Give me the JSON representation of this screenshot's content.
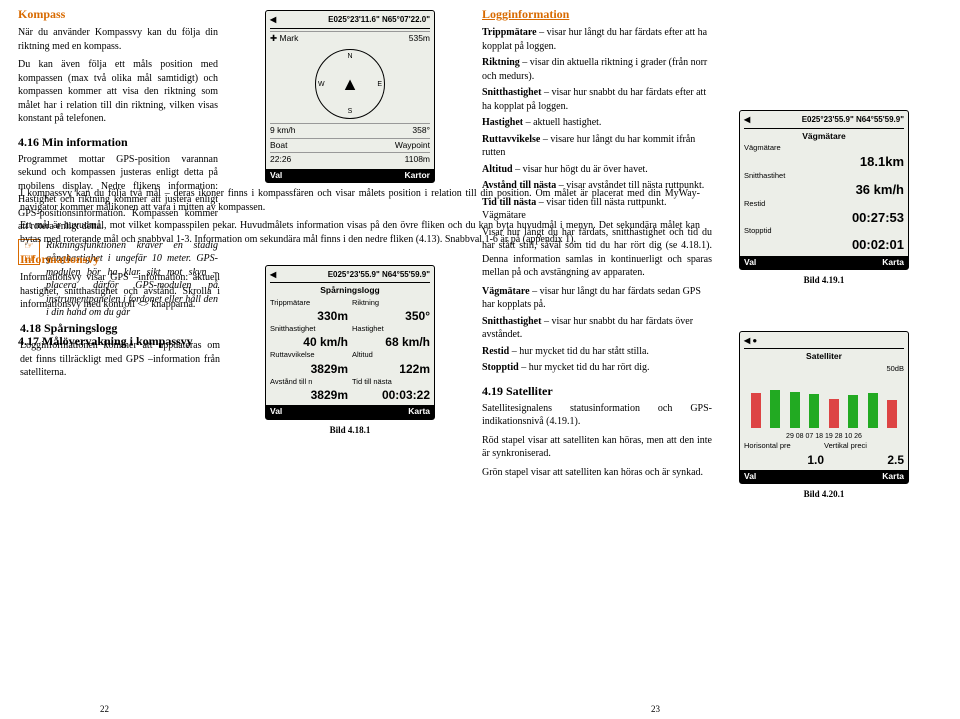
{
  "left": {
    "kompass_heading": "Kompass",
    "kompass_p1": "När du använder Kompassvy kan du följa din riktning med en kompass.",
    "kompass_p2": "Du kan även följa ett måls position med kompassen (max två olika mål samtidigt) och kompassen kommer att visa den riktning som målet har i relation till din riktning, vilken visas konstant på telefonen.",
    "s416_heading": "4.16  Min information",
    "s416_p1": "Programmet mottar GPS-position varannan sekund och kompassen justeras enligt detta på mobilens display. Nedre flikens information: Hastighet och riktning kommer att justera enligt GPS-positionsinformation. Kompassen kommer att rotera enligt detta.",
    "tip_label": "TIP",
    "tip_text": "Riktningsfunktionen kräver en stadig gånghastighet i ungefär 10 meter. GPS-modulen bör ha klar sikt mot skyn – placera därför GPS-modulen på instrumentpanelen i fordonet eller håll den i din hand om du går",
    "s417_heading": "4.17  Målövervakning i kompassvy",
    "s417_p1": "I kompassvy kan du följa två mål – deras ikoner finns i kompassfären och visar målets position i relation till din position. Om målet är placerat med din MyWay-navigator kommer målikonen att vara i mitten av kompassen.",
    "s417_p2": "Ett mål är huvudmål, mot vilket kompasspilen pekar. Huvudmålets information visas på den övre fliken och du kan byta huvudmål i menyn. Det sekundära målet kan bytas med roterande mål och snabbval 1-3. Information om sekundära mål finns i den nedre fliken (4.13). Snabbval 1-6 är på (appendix 1).",
    "info_heading": "Informationsvy",
    "info_p1": "Informationsvy visar GPS –information: aktuell hastighet, snitthastighet och avstånd. Skrolla i informationsvy med kontroll <> knapparna.",
    "s418_heading": "4.18  Spårningslogg",
    "s418_p1": "Logginformationen kommer att uppdateras om det finns tillräckligt med GPS –information från satelliterna.",
    "page_num_left": "22"
  },
  "mid": {
    "compass_screen": {
      "topbar_left": "◀",
      "topbar_mid": "E025°23'11.6\" N65°07'22.0\"",
      "mark_label": "✚ Mark",
      "mark_val": "535m",
      "compass_n": "N",
      "compass_s": "S",
      "compass_e": "E",
      "compass_w": "W",
      "speed": "9 km/h",
      "heading": "358°",
      "boat": "Boat",
      "waypoint": "Waypoint",
      "dist": "22:26",
      "alt": "1108m",
      "sk_left": "Val",
      "sk_right": "Kartor"
    },
    "log_screen": {
      "topbar_left": "◀",
      "topbar_mid": "E025°23'55.9\" N64°55'59.9\"",
      "title": "Spårningslogg",
      "f1_label": "Trippmätare",
      "f1_val": "330m",
      "f2_label": "Riktning",
      "f2_val": "350°",
      "f3_label": "Snitthastighet",
      "f3_val": "40 km/h",
      "f4_label": "Hastighet",
      "f4_val": "68 km/h",
      "f5_label": "Ruttavvikelse",
      "f5_val": "3829m",
      "f6_label": "Altitud",
      "f6_val": "122m",
      "f7_label": "Avstånd till n",
      "f7_val": "3829m",
      "f8_label": "Tid till nästa",
      "f8_val": "00:03:22",
      "sk_left": "Val",
      "sk_right": "Karta"
    },
    "caption": "Bild 4.18.1"
  },
  "right": {
    "log_heading": "Logginformation",
    "terms": [
      {
        "b": "Trippmätare",
        "t": " – visar hur långt du har färdats efter att ha kopplat på loggen."
      },
      {
        "b": "Riktning",
        "t": " – visar din aktuella riktning i grader (från norr och medurs)."
      },
      {
        "b": "Snitthastighet",
        "t": " – visar hur snabbt du har färdats efter att ha kopplat på loggen."
      },
      {
        "b": "Hastighet",
        "t": " – aktuell hastighet."
      },
      {
        "b": "Ruttavvikelse",
        "t": " – visare hur långt du har kommit ifrån rutten"
      },
      {
        "b": "Altitud",
        "t": " – visar hur högt du är över havet."
      },
      {
        "b": "Avstånd till nästa",
        "t": " – visar avståndet till nästa ruttpunkt."
      },
      {
        "b": "Tid till nästa",
        "t": " – visar tiden till nästa ruttpunkt. Vägmätare"
      }
    ],
    "vag_p1": "Visar hur långt du har färdats, snitthastighet och tid du har stått still, såväl som tid du har rört dig (se 4.18.1). Denna information samlas in kontinuerligt och sparas mellan på och avstängning av apparaten.",
    "terms2": [
      {
        "b": "Vägmätare",
        "t": " – visar hur långt du har färdats sedan GPS har kopplats på."
      },
      {
        "b": "Snitthastighet",
        "t": " – visar hur snabbt du har färdats över avståndet."
      },
      {
        "b": "Restid",
        "t": " – hur mycket tid du har stått stilla."
      },
      {
        "b": "Stopptid",
        "t": " – hur mycket tid du har rört dig."
      }
    ],
    "s419_heading": "4.19  Satelliter",
    "s419_p1": "Satellitesignalens statusinformation och GPS-indikationsnivå (4.19.1).",
    "s419_p2": "Röd stapel visar att satelliten kan höras, men att den inte är synkroniserad.",
    "s419_p3": "Grön stapel visar att satelliten kan höras och är synkad.",
    "page_num_right": "23"
  },
  "far": {
    "vag_screen": {
      "topbar_left": "◀",
      "topbar_mid": "E025°23'55.9\" N64°55'59.9\"",
      "title": "Vägmätare",
      "f1_label": "Vägmätare",
      "f1_val": "18.1km",
      "f2_label": "Snitthastihet",
      "f2_val": "36 km/h",
      "f3_label": "Restid",
      "f3_val": "00:27:53",
      "f4_label": "Stopptid",
      "f4_val": "00:02:01",
      "sk_left": "Val",
      "sk_right": "Karta"
    },
    "caption1": "Bild 4.19.1",
    "sat_screen": {
      "topbar_left": "◀ ●",
      "title": "Satelliter",
      "db": "50dB",
      "sat_ids": "29 08 07 18 19 28 10 26",
      "hz_label": "Horisontal pre",
      "hz_val": "1.0",
      "vt_label": "Vertikal preci",
      "vt_val": "2.5",
      "sk_left": "Val",
      "sk_right": "Karta"
    },
    "caption2": "Bild 4.20.1"
  }
}
